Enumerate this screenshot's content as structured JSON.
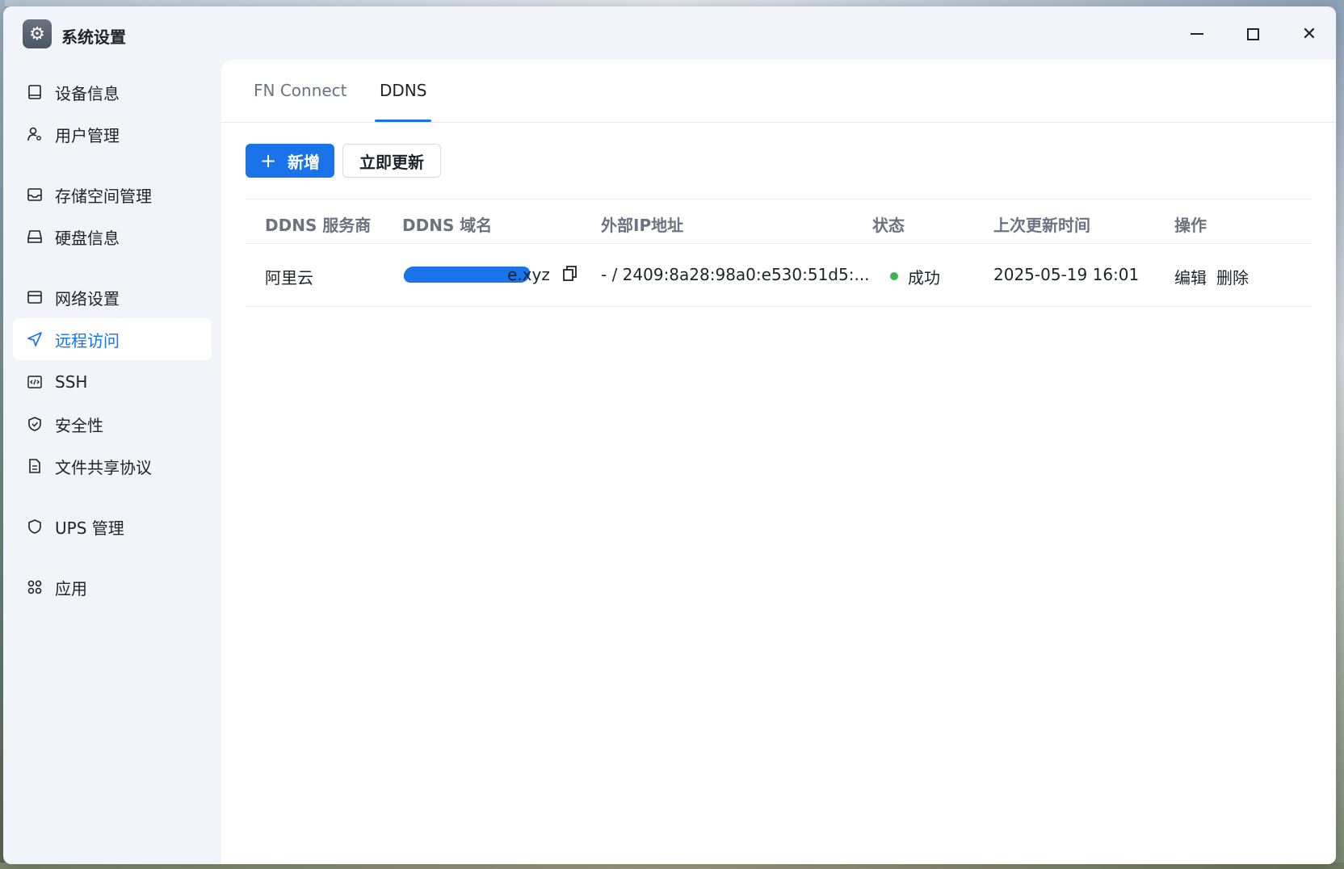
{
  "window": {
    "title": "系统设置",
    "app_icon": "gear-icon"
  },
  "sidebar": {
    "items": [
      {
        "label": "设备信息",
        "icon": "device-icon",
        "active": false
      },
      {
        "label": "用户管理",
        "icon": "user-gear-icon",
        "active": false
      },
      {
        "label": "存储空间管理",
        "icon": "storage-icon",
        "active": false
      },
      {
        "label": "硬盘信息",
        "icon": "disk-icon",
        "active": false
      },
      {
        "label": "网络设置",
        "icon": "network-icon",
        "active": false
      },
      {
        "label": "远程访问",
        "icon": "send-icon",
        "active": true
      },
      {
        "label": "SSH",
        "icon": "code-icon",
        "active": false
      },
      {
        "label": "安全性",
        "icon": "shield-check-icon",
        "active": false
      },
      {
        "label": "文件共享协议",
        "icon": "document-icon",
        "active": false
      },
      {
        "label": "UPS 管理",
        "icon": "shield-icon",
        "active": false
      },
      {
        "label": "应用",
        "icon": "apps-icon",
        "active": false
      }
    ]
  },
  "tabs": [
    {
      "label": "FN Connect",
      "active": false
    },
    {
      "label": "DDNS",
      "active": true
    }
  ],
  "toolbar": {
    "add_label": "新增",
    "refresh_label": "立即更新"
  },
  "table": {
    "columns": [
      "DDNS 服务商",
      "DDNS 域名",
      "外部IP地址",
      "状态",
      "上次更新时间",
      "操作"
    ],
    "rows": [
      {
        "provider": "阿里云",
        "domain_suffix": "e.xyz",
        "ip": "- / 2409:8a28:98a0:e530:51d5:...",
        "status": "成功",
        "updated": "2025-05-19 16:01",
        "edit": "编辑",
        "delete": "删除"
      }
    ]
  },
  "colors": {
    "accent": "#1a73e8",
    "success": "#3fb34f",
    "sidebar_bg": "#f1f4f8"
  }
}
